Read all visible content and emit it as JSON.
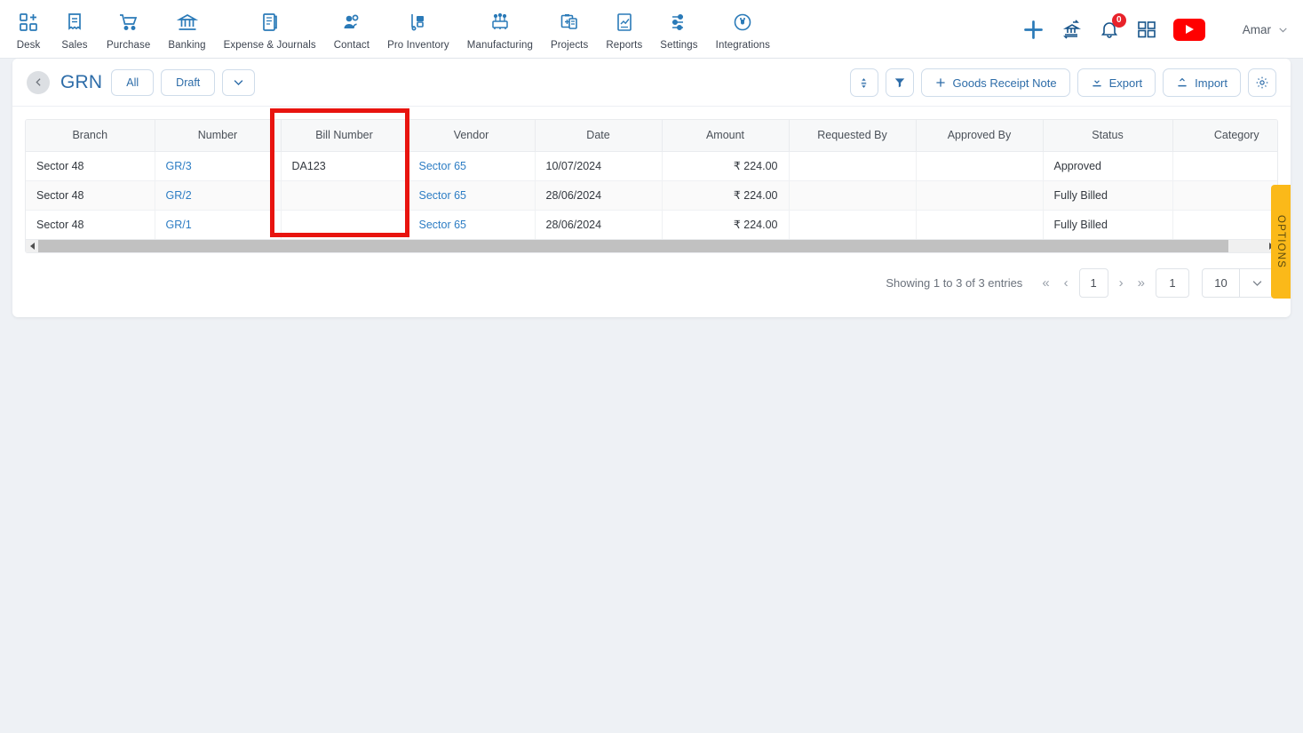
{
  "topnav": {
    "items": [
      {
        "label": "Desk",
        "icon": "desk-grid-plus-icon"
      },
      {
        "label": "Sales",
        "icon": "sales-receipt-icon"
      },
      {
        "label": "Purchase",
        "icon": "purchase-cart-icon"
      },
      {
        "label": "Banking",
        "icon": "banking-bank-icon"
      },
      {
        "label": "Expense & Journals",
        "icon": "expense-journal-icon"
      },
      {
        "label": "Contact",
        "icon": "contact-people-icon"
      },
      {
        "label": "Pro Inventory",
        "icon": "pro-inventory-icon"
      },
      {
        "label": "Manufacturing",
        "icon": "manufacturing-icon"
      },
      {
        "label": "Projects",
        "icon": "projects-clipboard-icon"
      },
      {
        "label": "Reports",
        "icon": "reports-chart-icon"
      },
      {
        "label": "Settings",
        "icon": "settings-sliders-icon"
      },
      {
        "label": "Integrations",
        "icon": "integrations-plug-icon"
      }
    ],
    "actions": {
      "add": "add-plus-icon",
      "bank_transfer": "bank-transfer-icon",
      "notifications": "notification-bell-icon",
      "notification_count": "0",
      "apps": "apps-grid-icon",
      "video": "youtube-play-icon"
    },
    "user": {
      "name": "Amar",
      "caret": "chevron-down-icon"
    }
  },
  "toolbar": {
    "back": "back-chevron-icon",
    "title": "GRN",
    "filters": [
      {
        "label": "All"
      },
      {
        "label": "Draft"
      }
    ],
    "filter_more": "chevron-down-icon",
    "right_buttons": [
      {
        "label": "",
        "icon": "sort-updown-icon",
        "name": "sort-button"
      },
      {
        "label": "",
        "icon": "filter-funnel-icon",
        "name": "filter-button"
      },
      {
        "label": "Goods Receipt Note",
        "icon": "plus-icon",
        "name": "new-goods-receipt-note-button"
      },
      {
        "label": "Export",
        "icon": "export-download-icon",
        "name": "export-button"
      },
      {
        "label": "Import",
        "icon": "import-upload-icon",
        "name": "import-button"
      },
      {
        "label": "",
        "icon": "gear-icon",
        "name": "settings-button"
      }
    ]
  },
  "table": {
    "columns": [
      "Branch",
      "Number",
      "Bill Number",
      "Vendor",
      "Date",
      "Amount",
      "Requested By",
      "Approved By",
      "Status",
      "Category"
    ],
    "rows": [
      {
        "branch": "Sector 48",
        "number": "GR/3",
        "bill_number": "DA123",
        "vendor": "Sector 65",
        "date": "10/07/2024",
        "amount": "₹ 224.00",
        "requested_by": "",
        "approved_by": "",
        "status": "Approved",
        "category": ""
      },
      {
        "branch": "Sector 48",
        "number": "GR/2",
        "bill_number": "",
        "vendor": "Sector 65",
        "date": "28/06/2024",
        "amount": "₹ 224.00",
        "requested_by": "",
        "approved_by": "",
        "status": "Fully Billed",
        "category": ""
      },
      {
        "branch": "Sector 48",
        "number": "GR/1",
        "bill_number": "",
        "vendor": "Sector 65",
        "date": "28/06/2024",
        "amount": "₹ 224.00",
        "requested_by": "",
        "approved_by": "",
        "status": "Fully Billed",
        "category": ""
      }
    ]
  },
  "pagination": {
    "showing": "Showing 1 to 3 of 3 entries",
    "first": "«",
    "prev": "‹",
    "current_page": "1",
    "next": "›",
    "last": "»",
    "jump_value": "1",
    "page_size": "10",
    "page_size_caret": "chevron-down-icon"
  },
  "options_tab": {
    "label": "OPTIONS"
  },
  "colors": {
    "accent_blue": "#2d6ca8",
    "link_blue": "#2d7dc4",
    "highlight_red": "#e8140f",
    "options_yellow": "#fbb919",
    "badge_red": "#e8222a",
    "page_bg": "#eef1f5"
  }
}
